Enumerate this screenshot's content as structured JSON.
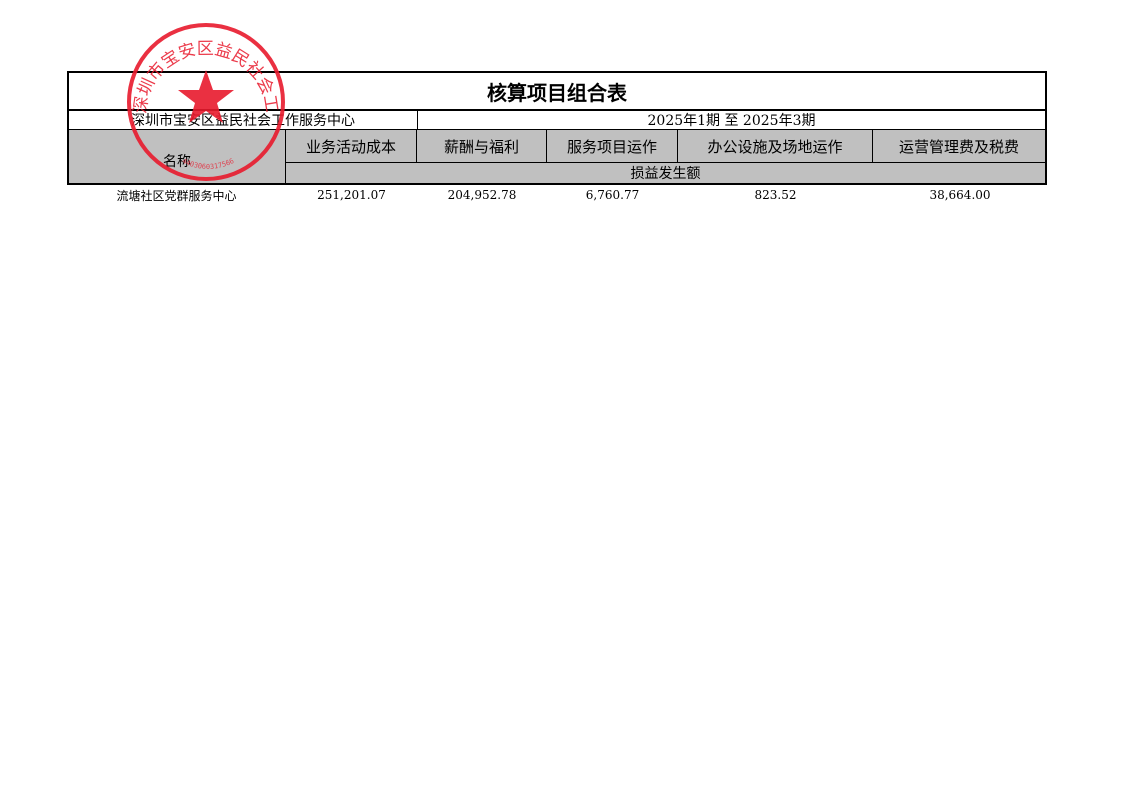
{
  "title": "核算项目组合表",
  "organization": "深圳市宝安区益民社会工作服务中心",
  "period": "2025年1期 至 2025年3期",
  "header": {
    "name": "名称",
    "columns": [
      "业务活动成本",
      "薪酬与福利",
      "服务项目运作",
      "办公设施及场地运作",
      "运营管理费及税费"
    ],
    "subheader": "损益发生额"
  },
  "rows": [
    {
      "name": "流塘社区党群服务中心",
      "values": [
        "251,201.07",
        "204,952.78",
        "6,760.77",
        "823.52",
        "38,664.00"
      ]
    }
  ],
  "stamp": {
    "text": "深圳市宝安区益民社会工作服务中心",
    "code": "4403060317566",
    "color": "#e8192c"
  }
}
